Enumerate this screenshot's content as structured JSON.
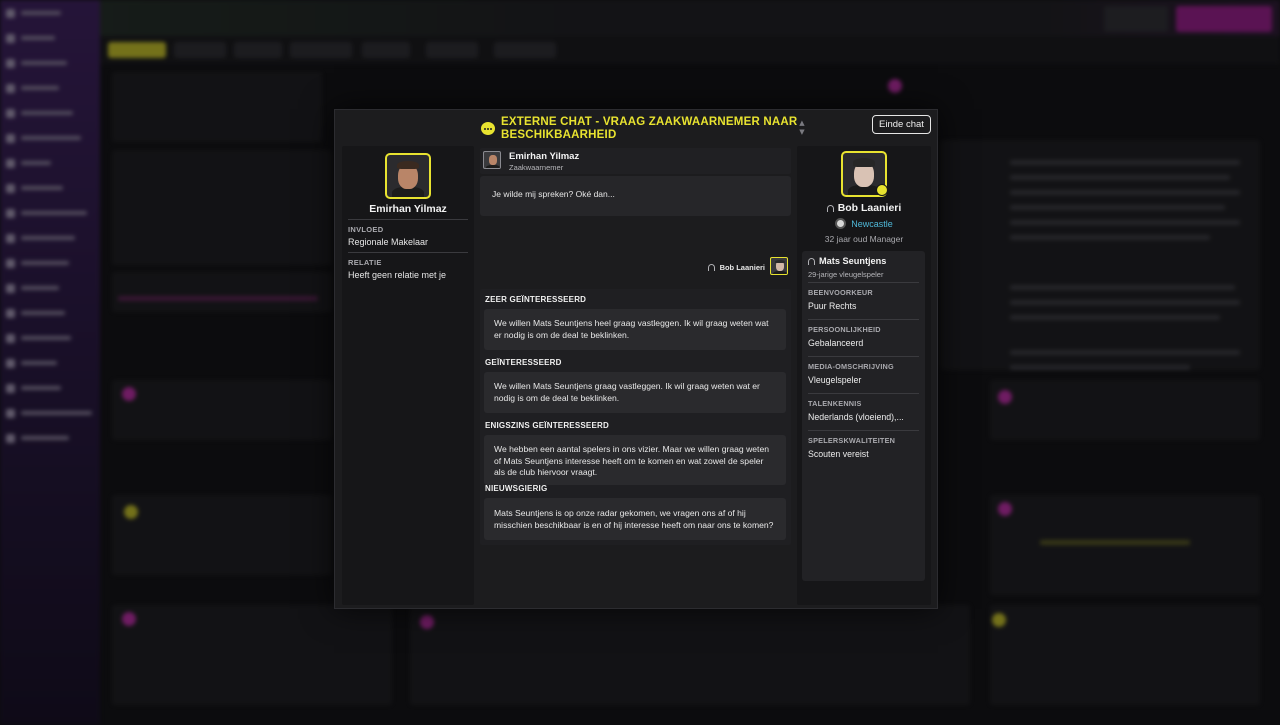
{
  "modal": {
    "title": "EXTERNE CHAT - VRAAG ZAAKWAARNEMER NAAR BESCHIKBAARHEID",
    "end_chat_label": "Einde chat"
  },
  "left_panel": {
    "name": "Emirhan Yilmaz",
    "fields": [
      {
        "label": "INVLOED",
        "value": "Regionale Makelaar"
      },
      {
        "label": "RELATIE",
        "value": "Heeft geen relatie met je"
      }
    ]
  },
  "conversation": {
    "sender_name": "Emirhan Yilmaz",
    "sender_role": "Zaakwaarnemer",
    "message": "Je wilde mij spreken? Oké dan...",
    "reply_by": "Bob Laanieri"
  },
  "options": [
    {
      "label": "ZEER GEÏNTERESSEERD",
      "lines": [
        "We willen Mats Seuntjens heel graag vastleggen. Ik wil graag weten wat",
        "er nodig is om de deal te beklinken."
      ]
    },
    {
      "label": "GEÏNTERESSEERD",
      "lines": [
        "We willen Mats Seuntjens graag vastleggen. Ik wil graag weten wat er",
        "nodig is om de deal te beklinken."
      ]
    },
    {
      "label": "ENIGSZINS GEÏNTERESSEERD",
      "lines": [
        "We hebben een aantal spelers in ons vizier. Maar we willen graag weten",
        "of Mats Seuntjens interesse heeft om te komen en wat zowel de speler",
        "als de club hiervoor vraagt."
      ]
    },
    {
      "label": "NIEUWSGIERIG",
      "lines": [
        "Mats Seuntjens is op onze radar gekomen, we vragen ons af of hij",
        "misschien beschikbaar is en of hij interesse heeft om naar ons te komen?"
      ]
    }
  ],
  "right_panel": {
    "manager_name": "Bob Laanieri",
    "club": "Newcastle",
    "manager_info": "32 jaar oud Manager",
    "player": {
      "name": "Mats Seuntjens",
      "subtitle": "29-jarige vleugelspeler",
      "attributes": [
        {
          "label": "BEENVOORKEUR",
          "value": "Puur Rechts"
        },
        {
          "label": "PERSOONLIJKHEID",
          "value": "Gebalanceerd"
        },
        {
          "label": "MEDIA-OMSCHRIJVING",
          "value": "Vleugelspeler"
        },
        {
          "label": "TALENKENNIS",
          "value": "Nederlands (vloeiend),..."
        },
        {
          "label": "SPELERSKWALITEITEN",
          "value": "Scouten vereist"
        }
      ]
    }
  },
  "colors": {
    "accent_yellow": "#e8e330",
    "link_blue": "#4fb8d8",
    "panel_dark": "#1c1c1e",
    "brand_purple": "#9b1a8c"
  },
  "icons": [
    "chat-bubble-icon",
    "chevron-up-icon",
    "chevron-down-icon",
    "headset-icon",
    "club-crest-icon",
    "chat-badge-icon"
  ]
}
